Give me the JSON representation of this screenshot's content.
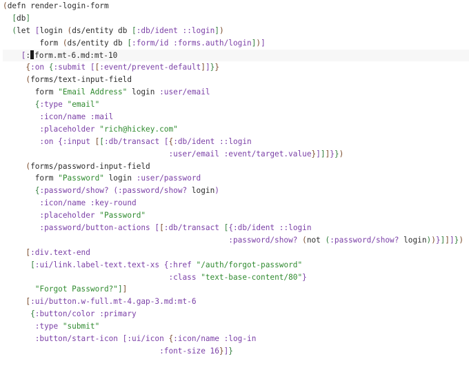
{
  "colors": {
    "p": "#2b2b2b",
    "b1": "#7a4a2a",
    "b2": "#2f7d3a",
    "b3": "#7a3fa6",
    "key": "#7a3fa6",
    "str": "#2f8a2f",
    "sym": "#2b2b2b",
    "ns": "#2b2b2b"
  },
  "lines": [
    [
      [
        "(",
        "b1"
      ],
      [
        "defn render-login-form",
        "p"
      ]
    ],
    [
      [
        "  [",
        "b2"
      ],
      [
        "db",
        "p"
      ],
      [
        "]",
        "b2"
      ]
    ],
    [
      [
        "  (",
        "b2"
      ],
      [
        "let ",
        "p"
      ],
      [
        "[",
        "b3"
      ],
      [
        "login ",
        "p"
      ],
      [
        "(",
        "b1"
      ],
      [
        "ds/entity db ",
        "p"
      ],
      [
        "[",
        "b2"
      ],
      [
        ":db/ident ::login",
        "key"
      ],
      [
        "]",
        "b2"
      ],
      [
        ")",
        "b1"
      ]
    ],
    [
      [
        "        form ",
        "p"
      ],
      [
        "(",
        "b1"
      ],
      [
        "ds/entity db ",
        "p"
      ],
      [
        "[",
        "b2"
      ],
      [
        ":form/id :forms.auth/login",
        "key"
      ],
      [
        "]",
        "b2"
      ],
      [
        ")",
        "b1"
      ],
      [
        "]",
        "b3"
      ]
    ],
    [
      [
        "    [",
        "b3"
      ],
      [
        ":",
        "p"
      ],
      [
        "__CURSOR__",
        "p"
      ],
      [
        "form.mt-6.md:mt-10",
        "p"
      ]
    ],
    [
      [
        "     {",
        "b1"
      ],
      [
        ":on ",
        "key"
      ],
      [
        "{",
        "b2"
      ],
      [
        ":submit ",
        "key"
      ],
      [
        "[",
        "b3"
      ],
      [
        "[",
        "b1"
      ],
      [
        ":event/prevent-default",
        "key"
      ],
      [
        "]",
        "b1"
      ],
      [
        "]",
        "b3"
      ],
      [
        "}",
        "b2"
      ],
      [
        "}",
        "b1"
      ]
    ],
    [
      [
        "     (",
        "b1"
      ],
      [
        "forms/text-input-field",
        "p"
      ]
    ],
    [
      [
        "       form ",
        "p"
      ],
      [
        "\"Email Address\"",
        "str"
      ],
      [
        " login ",
        "p"
      ],
      [
        ":user/email",
        "key"
      ]
    ],
    [
      [
        "       {",
        "b2"
      ],
      [
        ":type ",
        "key"
      ],
      [
        "\"email\"",
        "str"
      ]
    ],
    [
      [
        "        :icon/name :mail",
        "key"
      ]
    ],
    [
      [
        "        :placeholder ",
        "key"
      ],
      [
        "\"rich@hickey.com\"",
        "str"
      ]
    ],
    [
      [
        "        :on ",
        "key"
      ],
      [
        "{",
        "b3"
      ],
      [
        ":input ",
        "key"
      ],
      [
        "[",
        "b1"
      ],
      [
        "[",
        "b2"
      ],
      [
        ":db/transact ",
        "key"
      ],
      [
        "[",
        "b3"
      ],
      [
        "{",
        "b1"
      ],
      [
        ":db/ident ::login",
        "key"
      ]
    ],
    [
      [
        "                                    :user/email :event/target.value",
        "key"
      ],
      [
        "}",
        "b1"
      ],
      [
        "]",
        "b3"
      ],
      [
        "]",
        "b2"
      ],
      [
        "]",
        "b1"
      ],
      [
        "}",
        "b3"
      ],
      [
        "}",
        "b2"
      ],
      [
        ")",
        "b1"
      ]
    ],
    [
      [
        "     (",
        "b1"
      ],
      [
        "forms/password-input-field",
        "p"
      ]
    ],
    [
      [
        "       form ",
        "p"
      ],
      [
        "\"Password\"",
        "str"
      ],
      [
        " login ",
        "p"
      ],
      [
        ":user/password",
        "key"
      ]
    ],
    [
      [
        "       {",
        "b2"
      ],
      [
        ":password/show? ",
        "key"
      ],
      [
        "(",
        "b3"
      ],
      [
        ":password/show? ",
        "key"
      ],
      [
        "login",
        "p"
      ],
      [
        ")",
        "b3"
      ]
    ],
    [
      [
        "        :icon/name :key-round",
        "key"
      ]
    ],
    [
      [
        "        :placeholder ",
        "key"
      ],
      [
        "\"Password\"",
        "str"
      ]
    ],
    [
      [
        "        :password/button-actions ",
        "key"
      ],
      [
        "[",
        "b3"
      ],
      [
        "[",
        "b1"
      ],
      [
        ":db/transact ",
        "key"
      ],
      [
        "[",
        "b2"
      ],
      [
        "{",
        "b3"
      ],
      [
        ":db/ident ::login",
        "key"
      ]
    ],
    [
      [
        "                                                 :password/show? ",
        "key"
      ],
      [
        "(",
        "b1"
      ],
      [
        "not ",
        "p"
      ],
      [
        "(",
        "b2"
      ],
      [
        ":password/show? ",
        "key"
      ],
      [
        "login",
        "p"
      ],
      [
        ")",
        "b2"
      ],
      [
        ")",
        "b1"
      ],
      [
        "}",
        "b3"
      ],
      [
        "]",
        "b2"
      ],
      [
        "]",
        "b1"
      ],
      [
        "]",
        "b3"
      ],
      [
        "}",
        "b2"
      ],
      [
        ")",
        "b1"
      ]
    ],
    [
      [
        "     [",
        "b1"
      ],
      [
        ":div.text-end",
        "key"
      ]
    ],
    [
      [
        "      [",
        "b2"
      ],
      [
        ":ui/link.label-text.text-xs ",
        "key"
      ],
      [
        "{",
        "b3"
      ],
      [
        ":href ",
        "key"
      ],
      [
        "\"/auth/forgot-password\"",
        "str"
      ]
    ],
    [
      [
        "                                    :class ",
        "key"
      ],
      [
        "\"text-base-content/80\"",
        "str"
      ],
      [
        "}",
        "b3"
      ]
    ],
    [
      [
        "       \"Forgot Password?\"",
        "str"
      ],
      [
        "]",
        "b2"
      ],
      [
        "]",
        "b1"
      ]
    ],
    [
      [
        "     [",
        "b1"
      ],
      [
        ":ui/button.w-full.mt-4.gap-3.md:mt-6",
        "key"
      ]
    ],
    [
      [
        "      {",
        "b2"
      ],
      [
        ":button/color :primary",
        "key"
      ]
    ],
    [
      [
        "       :type ",
        "key"
      ],
      [
        "\"submit\"",
        "str"
      ]
    ],
    [
      [
        "       :button/start-icon ",
        "key"
      ],
      [
        "[",
        "b3"
      ],
      [
        ":ui/icon ",
        "key"
      ],
      [
        "{",
        "b1"
      ],
      [
        ":icon/name :log-in",
        "key"
      ]
    ],
    [
      [
        "                                  :font-size 16",
        "key"
      ],
      [
        "}",
        "b1"
      ],
      [
        "]",
        "b3"
      ],
      [
        "}",
        "b2"
      ]
    ],
    [
      [
        "        ",
        "p"
      ]
    ]
  ]
}
